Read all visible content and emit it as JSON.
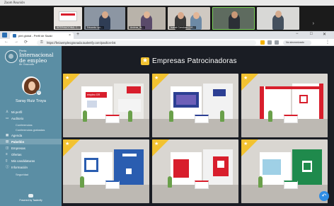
{
  "zoom": {
    "title": "Zoom Reunión",
    "participants": [
      {
        "name": "INTERNACIONAL C…",
        "icon": "participant-camera"
      },
      {
        "name": "Eduardo Ign…",
        "icon": "participant-camera"
      },
      {
        "name": "Andrea_IN…",
        "icon": "participant-camera"
      },
      {
        "name": "Isabel Ceminas (LM…",
        "icon": "participant-camera"
      },
      {
        "name": "",
        "icon": "participant-camera"
      },
      {
        "name": "",
        "icon": "participant-camera"
      }
    ],
    "icons": {
      "next": "chevron-right-icon"
    }
  },
  "browser": {
    "tab_label": "pint global - Perfil de Saaki",
    "tab_close": "×",
    "new_tab": "+",
    "window_controls": [
      "−",
      "□",
      "✕"
    ],
    "nav": [
      "←",
      "→",
      "⟳"
    ],
    "url": "https://feriaempleogranada.taalentfy.com/pavilion-list",
    "not_sync": "No sincronizado",
    "kebab": "⋮"
  },
  "sidebar": {
    "logo": {
      "line1": "Feria",
      "line2": "Internacional",
      "line3": "de empleo",
      "line4": "de Granada"
    },
    "user_name": "Saray Ruiz Troya",
    "avatar_badge": "⊙",
    "items": [
      {
        "label": "Mi perfil",
        "icon": "user-icon",
        "glyph": "♙",
        "sub": false,
        "active": false
      },
      {
        "label": "Auditorio",
        "icon": "video-icon",
        "glyph": "▭",
        "sub": false,
        "active": false
      },
      {
        "label": "Conferencias",
        "icon": "",
        "glyph": "",
        "sub": true,
        "active": false
      },
      {
        "label": "Conferencias grabadas",
        "icon": "",
        "glyph": "",
        "sub": true,
        "active": false
      },
      {
        "label": "Agenda",
        "icon": "calendar-icon",
        "glyph": "▦",
        "sub": false,
        "active": false
      },
      {
        "label": "Pabellón",
        "icon": "building-icon",
        "glyph": "▤",
        "sub": false,
        "active": true
      },
      {
        "label": "Empresas",
        "icon": "briefcase-icon",
        "glyph": "◫",
        "sub": false,
        "active": false
      },
      {
        "label": "Ofertas",
        "icon": "list-icon",
        "glyph": "≡",
        "sub": false,
        "active": false
      },
      {
        "label": "Mis candidaturas",
        "icon": "folder-icon",
        "glyph": "▯",
        "sub": false,
        "active": false
      },
      {
        "label": "Información",
        "icon": "info-icon",
        "glyph": "ⓘ",
        "sub": false,
        "active": false
      },
      {
        "label": "Seguridad",
        "icon": "",
        "glyph": "",
        "sub": true,
        "active": false
      }
    ],
    "powered": "Powered by Taalentfy"
  },
  "main": {
    "title": "Empresas Patrocinadoras",
    "booths": [
      {
        "name": "booth-1",
        "accent": "#d81e2c",
        "sign": "empleo GR",
        "wall": "#ffffff"
      },
      {
        "name": "booth-2",
        "accent": "#2c3f93",
        "sign": "",
        "wall": "#ffffff"
      },
      {
        "name": "booth-3",
        "accent": "#d81e2c",
        "sign": "",
        "wall": "#ffffff"
      },
      {
        "name": "booth-4",
        "accent": "#2a5db0",
        "sign": "",
        "wall": "#ffffff"
      },
      {
        "name": "booth-5",
        "accent": "#d81e2c",
        "sign": "",
        "wall": "#ffffff"
      },
      {
        "name": "booth-6",
        "accent": "#1f8a4c",
        "sign": "",
        "wall": "#ffffff"
      }
    ],
    "back_button": "↶"
  }
}
